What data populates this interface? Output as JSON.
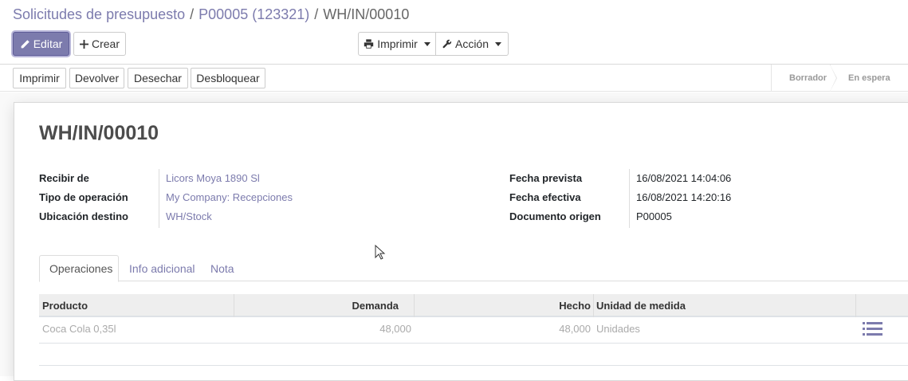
{
  "breadcrumb": {
    "items": [
      "Solicitudes de presupuesto",
      "P00005 (123321)"
    ],
    "separator": "/",
    "current": "WH/IN/00010"
  },
  "toolbar": {
    "edit_label": "Editar",
    "create_label": "Crear",
    "print_label": "Imprimir",
    "action_label": "Acción"
  },
  "status_buttons": [
    "Imprimir",
    "Devolver",
    "Desechar",
    "Desbloquear"
  ],
  "stages": [
    "Borrador",
    "En espera"
  ],
  "record": {
    "title": "WH/IN/00010",
    "left_fields": [
      {
        "label": "Recibir de",
        "value": "Licors Moya 1890 Sl"
      },
      {
        "label": "Tipo de operación",
        "value": "My Company: Recepciones"
      },
      {
        "label": "Ubicación destino",
        "value": "WH/Stock"
      }
    ],
    "right_fields": [
      {
        "label": "Fecha prevista",
        "value": "16/08/2021 14:04:06"
      },
      {
        "label": "Fecha efectiva",
        "value": "16/08/2021 14:20:16"
      },
      {
        "label": "Documento origen",
        "value": "P00005"
      }
    ]
  },
  "tabs": [
    "Operaciones",
    "Info adicional",
    "Nota"
  ],
  "table": {
    "columns": [
      "Producto",
      "Demanda",
      "Hecho",
      "Unidad de medida"
    ],
    "rows": [
      {
        "producto": "Coca Cola 0,35l",
        "demanda": "48,000",
        "hecho": "48,000",
        "unidad": "Unidades"
      }
    ]
  },
  "colors": {
    "brand": "#7c7bad",
    "text": "#4c4c4c"
  }
}
